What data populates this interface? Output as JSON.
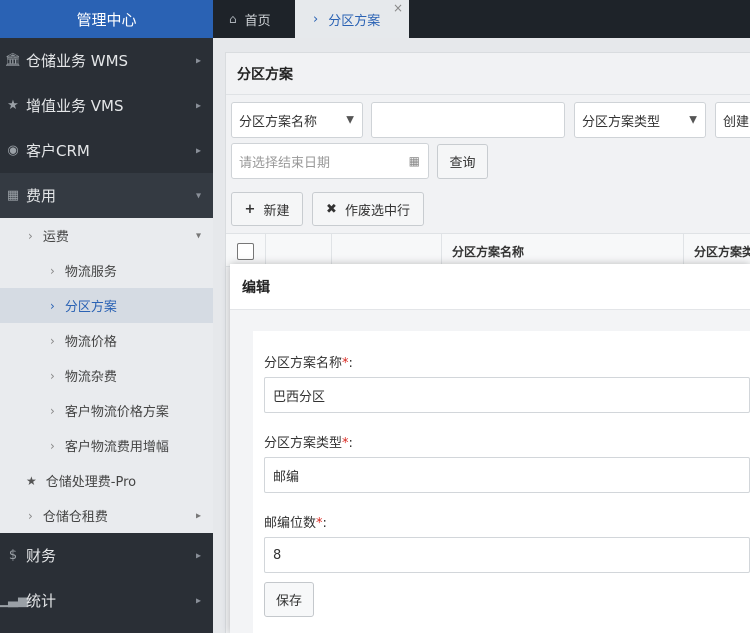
{
  "sidebar": {
    "brand": "管理中心",
    "items": [
      {
        "label": "仓储业务 WMS",
        "icon": "bank-icon"
      },
      {
        "label": "增值业务 VMS",
        "icon": "star-icon"
      },
      {
        "label": "客户CRM",
        "icon": "user-circle-icon"
      },
      {
        "label": "费用",
        "icon": "table-icon"
      },
      {
        "label": "财务",
        "icon": "dollar-icon"
      },
      {
        "label": "统计",
        "icon": "bar-chart-icon"
      }
    ],
    "freight": "运费",
    "sub_items": [
      "物流服务",
      "分区方案",
      "物流价格",
      "物流杂费",
      "客户物流价格方案",
      "客户物流费用增幅"
    ],
    "storage_pro": "仓储处理费-Pro",
    "storage_rent": "仓储仓租费"
  },
  "tabs": {
    "home": "首页",
    "active": "分区方案"
  },
  "panel": {
    "title": "分区方案",
    "filter_name_select": "分区方案名称",
    "filter_type_select": "分区方案类型",
    "filter_created": "创建",
    "end_date_placeholder": "请选择结束日期",
    "query_button": "查询",
    "new_button": "新建",
    "void_button": "作废选中行",
    "columns": [
      "分区方案名称",
      "分区方案类"
    ]
  },
  "modal": {
    "title": "编辑",
    "name_label": "分区方案名称",
    "name_value": "巴西分区",
    "type_label": "分区方案类型",
    "type_value": "邮编",
    "digits_label": "邮编位数",
    "digits_value": "8",
    "required_mark": "*",
    "colon": ":",
    "save_button": "保存"
  },
  "colors": {
    "brand": "#2a62b4",
    "sidebar": "#2a2f36",
    "required": "#d9251d"
  }
}
